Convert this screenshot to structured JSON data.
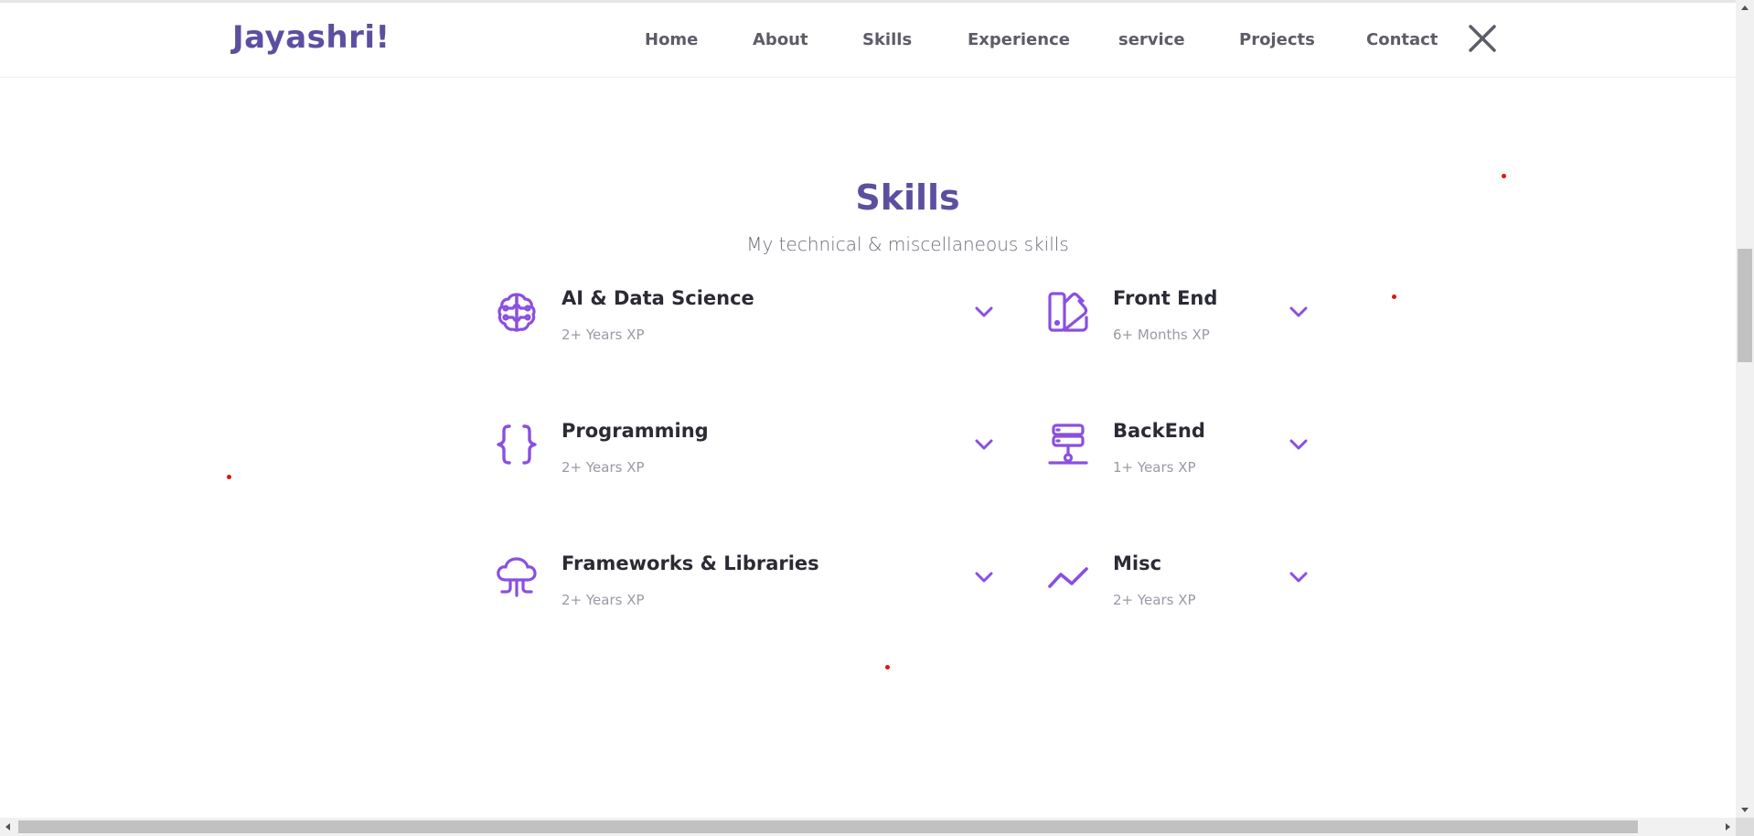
{
  "header": {
    "logo": "Jayashri!",
    "nav": [
      "Home",
      "About",
      "Skills",
      "Experience",
      "service",
      "Projects",
      "Contact"
    ],
    "close_icon": "close-icon"
  },
  "skills": {
    "title": "Skills",
    "subtitle": "My technical & miscellaneous skills",
    "items": [
      {
        "title": "AI & Data Science",
        "experience": "2+ Years XP",
        "icon": "brain-icon"
      },
      {
        "title": "Front End",
        "experience": "6+ Months XP",
        "icon": "palette-icon"
      },
      {
        "title": "Programming",
        "experience": "2+ Years XP",
        "icon": "braces-icon"
      },
      {
        "title": "BackEnd",
        "experience": "1+ Years XP",
        "icon": "server-icon"
      },
      {
        "title": "Frameworks & Libraries",
        "experience": "2+ Years XP",
        "icon": "cloud-icon"
      },
      {
        "title": "Misc",
        "experience": "2+ Years XP",
        "icon": "trend-icon"
      }
    ]
  },
  "colors": {
    "accent": "#8a4fe0",
    "heading": "#5d4f9f",
    "dot": "#e01414"
  }
}
